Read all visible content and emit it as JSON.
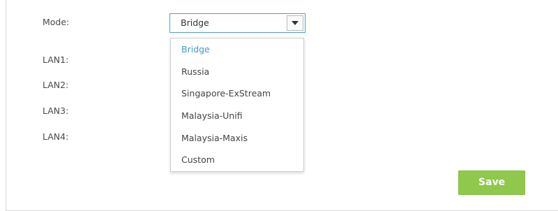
{
  "form": {
    "mode_label": "Mode:",
    "lan_labels": [
      "LAN1:",
      "LAN2:",
      "LAN3:",
      "LAN4:"
    ]
  },
  "mode_select": {
    "selected_value": "Bridge",
    "arrow_icon": "chevron-down-icon",
    "options": [
      {
        "label": "Bridge",
        "selected": true
      },
      {
        "label": "Russia",
        "selected": false
      },
      {
        "label": "Singapore-ExStream",
        "selected": false
      },
      {
        "label": "Malaysia-Unifi",
        "selected": false
      },
      {
        "label": "Malaysia-Maxis",
        "selected": false
      },
      {
        "label": "Custom",
        "selected": false
      }
    ]
  },
  "actions": {
    "save_label": "Save"
  },
  "colors": {
    "accent_blue": "#3d9ad6",
    "save_green": "#8fc84a",
    "select_border": "#4f9fd6"
  }
}
